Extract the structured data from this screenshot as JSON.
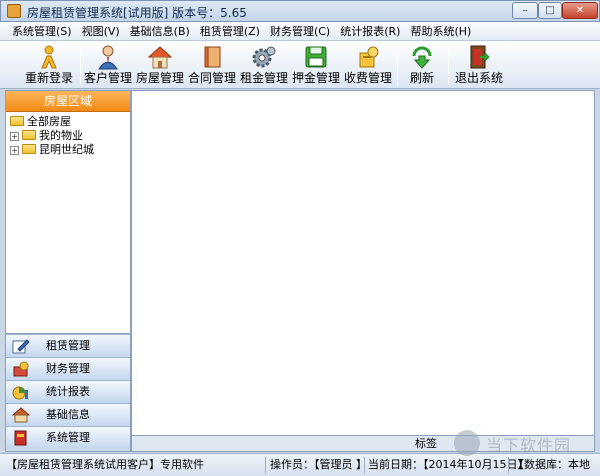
{
  "window": {
    "title": "房屋租赁管理系统[试用版]  版本号：5.65",
    "minimize_glyph": "–",
    "maximize_glyph": "□",
    "close_glyph": "✕"
  },
  "menu": [
    "系统管理(S)",
    "视图(V)",
    "基础信息(B)",
    "租赁管理(Z)",
    "财务管理(C)",
    "统计报表(R)",
    "帮助系统(H)"
  ],
  "toolbar": {
    "relogin": "重新登录",
    "customers": "客户管理",
    "houses": "房屋管理",
    "contracts": "合同管理",
    "rent": "租金管理",
    "deposit": "押金管理",
    "fees": "收费管理",
    "refresh": "刷新",
    "exit": "退出系统"
  },
  "left_panel": {
    "header": "房屋区域",
    "tree": {
      "root": "全部房屋",
      "children": [
        "我的物业",
        "昆明世纪城"
      ],
      "expander_glyph": "+"
    },
    "nav": [
      {
        "label": "租赁管理",
        "icon": "pen-icon"
      },
      {
        "label": "财务管理",
        "icon": "finance-icon"
      },
      {
        "label": "统计报表",
        "icon": "chart-icon"
      },
      {
        "label": "基础信息",
        "icon": "house-icon"
      },
      {
        "label": "系统管理",
        "icon": "book-icon"
      }
    ]
  },
  "main": {
    "tab_label": "标签"
  },
  "status": {
    "product": "【房屋租赁管理系统试用客户】专用软件",
    "operator": "操作员：【管理员 】",
    "date": "当前日期：【2014年10月15日】",
    "database": "【数据库：本地"
  },
  "watermark": {
    "text": "当下软件园"
  },
  "colors": {
    "panel_header": "#f08a14",
    "accent_blue": "#c5d7ee"
  }
}
